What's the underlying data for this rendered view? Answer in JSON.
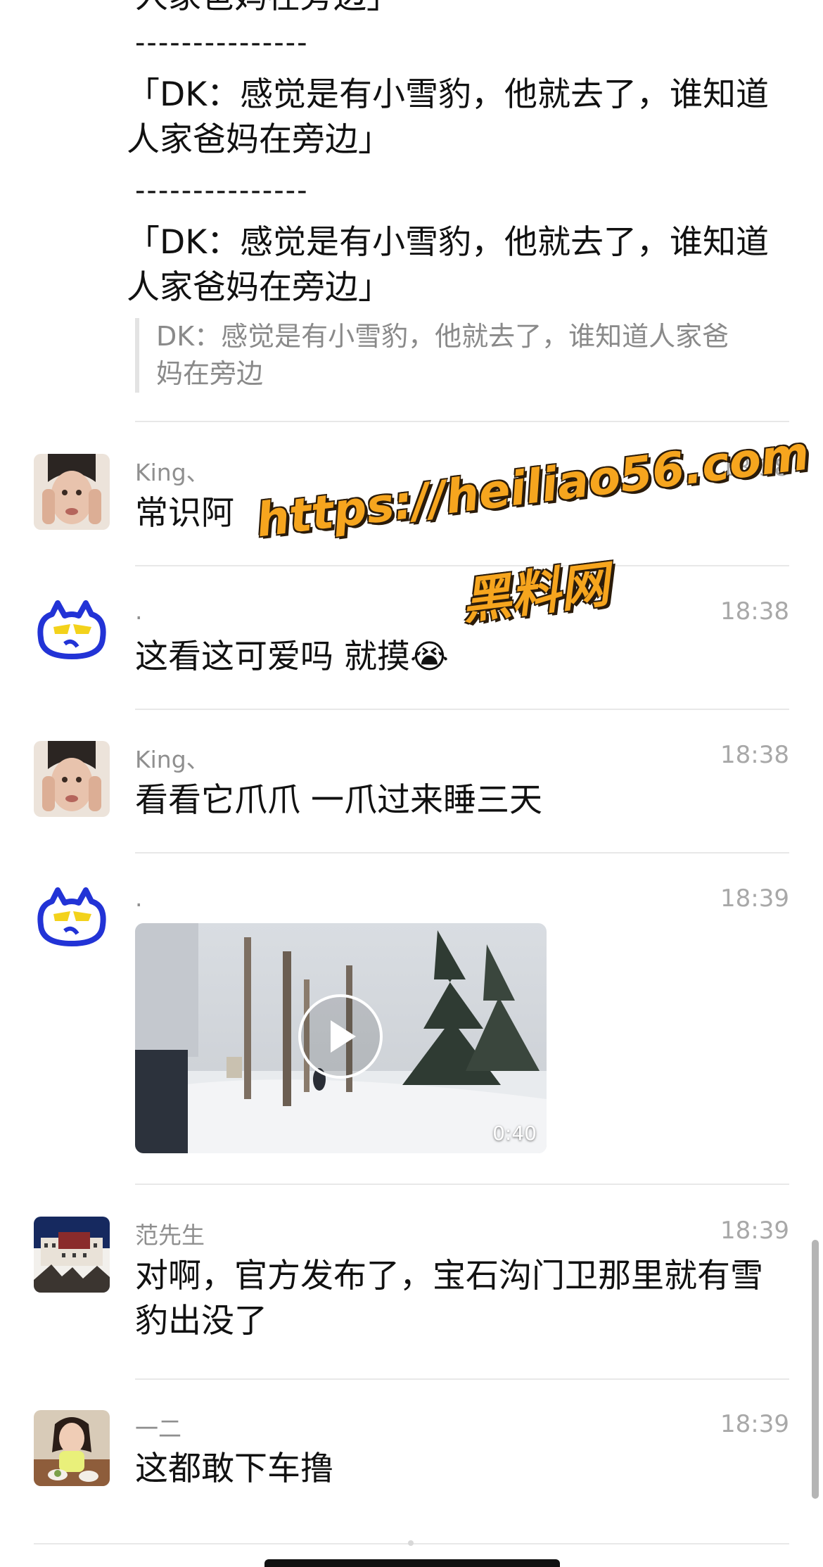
{
  "top_message": {
    "partial_line": "人家爸妈在旁边」",
    "separator": "---------------",
    "quoted_lines": [
      "「DK：感觉是有小雪豹，他就去了，谁知道\n人家爸妈在旁边」",
      "「DK：感觉是有小雪豹，他就去了，谁知道\n人家爸妈在旁边」"
    ],
    "reply_quote": "DK：感觉是有小雪豹，他就去了，谁知道人家爸\n妈在旁边"
  },
  "messages": [
    {
      "sender": "King、",
      "time": "18:38",
      "text": "常识阿",
      "avatar": "woman-hands-face-avatar"
    },
    {
      "sender": ".",
      "time": "18:38",
      "text": "这看这可爱吗 就摸😭",
      "avatar": "blue-cat-logo-avatar"
    },
    {
      "sender": "King、",
      "time": "18:38",
      "text": "看看它爪爪 一爪过来睡三天",
      "avatar": "woman-hands-face-avatar"
    },
    {
      "sender": ".",
      "time": "18:39",
      "video_duration": "0:40",
      "avatar": "blue-cat-logo-avatar"
    },
    {
      "sender": "范先生",
      "time": "18:39",
      "text": "对啊，官方发布了，宝石沟门卫那里就有雪\n豹出没了",
      "avatar": "palace-photo-avatar"
    },
    {
      "sender": "一二",
      "time": "18:39",
      "text": "这都敢下车撸",
      "avatar": "girl-photo-avatar"
    }
  ],
  "watermark": {
    "url": "https://heiliao56.com",
    "name": "黑料网"
  },
  "colors": {
    "text": "#111111",
    "name": "#8f8f8f",
    "time": "#a8a8a8",
    "divider": "#e8e8e8",
    "watermark": "#f6a51e"
  }
}
